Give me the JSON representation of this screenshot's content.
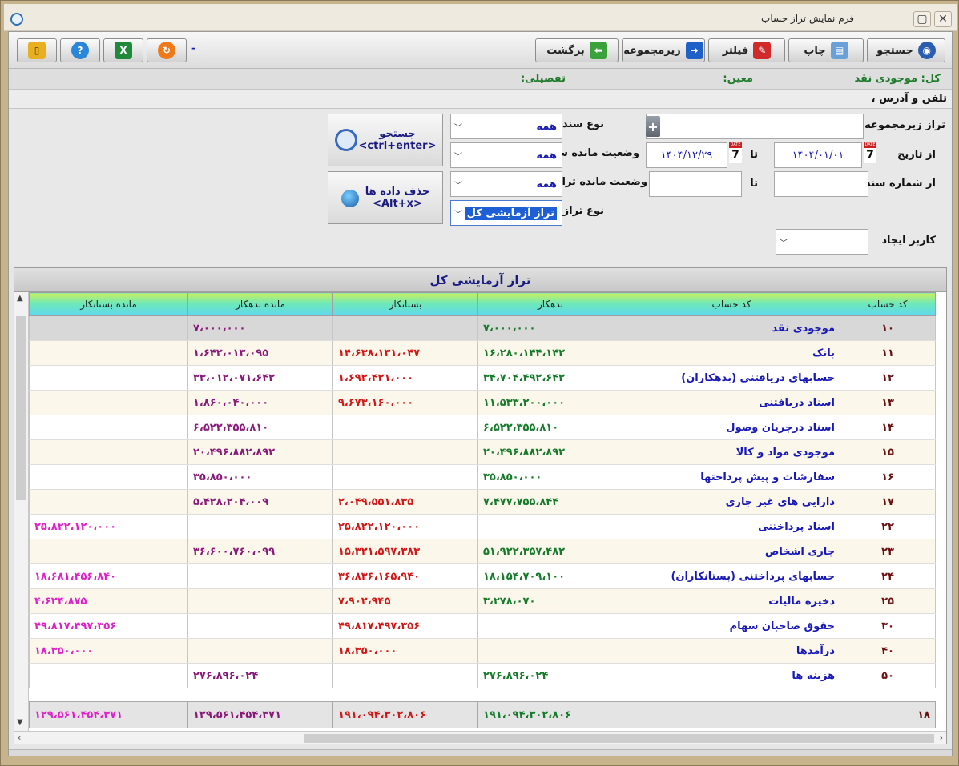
{
  "window": {
    "title": "فرم نمایش  تراز حساب"
  },
  "toolbar": {
    "search_label": "جستجو",
    "print_label": "چاپ",
    "filter_label": "فیلتر",
    "subgroup_label": "زیرمجموعه",
    "back_label": "برگشت",
    "separator_text": "-"
  },
  "info": {
    "kol": "کل: موجودی نقد",
    "moin": "معین:",
    "tafsili": "تفصیلی:"
  },
  "address": {
    "text": "تلفن و آدرس ،"
  },
  "filters": {
    "subgroup_balance_label": "تراز زیرمجموعه",
    "subgroup_balance_value": "",
    "doc_type_label": "نوع سند",
    "doc_type_value": "همه",
    "from_date_label": "از تاریخ",
    "from_date_value": "۱۴۰۴/۰۱/۰۱",
    "to_label": "تا",
    "to_date_value": "۱۴۰۴/۱۲/۲۹",
    "doc_remain_status_label": "وضعیت مانده سند",
    "doc_remain_status_value": "همه",
    "from_doc_no_label": "از شماره سند",
    "from_doc_no_value": "",
    "to_doc_no_value": "",
    "balance_remain_status_label": "وضعیت مانده تراز",
    "balance_remain_status_value": "همه",
    "balance_type_label": "نوع تراز",
    "balance_type_value": "تراز آزمایشی کل",
    "creator_label": "کاربر ایجاد",
    "creator_value": "",
    "calendar_top": "DATE",
    "calendar_num": "7"
  },
  "actions": {
    "search_line1": "جستجو",
    "search_line2": "<ctrl+enter>",
    "delete_line1": "حذف داده ها",
    "delete_line2": "<Alt+x>"
  },
  "grid": {
    "title": "تراز آزمایشی کل",
    "columns": [
      "کد حساب",
      "کد حساب",
      "بدهکار",
      "بستانکار",
      "مانده بدهکار",
      "مانده بستانکار"
    ],
    "rows": [
      {
        "code": "۱۰",
        "name": "موجودی نقد",
        "debit": "۷،۰۰۰،۰۰۰",
        "credit": "",
        "rem_debit": "۷،۰۰۰،۰۰۰",
        "rem_credit": ""
      },
      {
        "code": "۱۱",
        "name": "بانک",
        "debit": "۱۶،۲۸۰،۱۴۴،۱۴۲",
        "credit": "۱۴،۶۳۸،۱۳۱،۰۴۷",
        "rem_debit": "۱،۶۴۲،۰۱۳،۰۹۵",
        "rem_credit": ""
      },
      {
        "code": "۱۲",
        "name": "حسابهای دریافتنی (بدهکاران)",
        "debit": "۳۴،۷۰۴،۴۹۲،۶۴۲",
        "credit": "۱،۶۹۲،۴۲۱،۰۰۰",
        "rem_debit": "۳۳،۰۱۲،۰۷۱،۶۴۲",
        "rem_credit": ""
      },
      {
        "code": "۱۳",
        "name": "اسناد دریافتنی",
        "debit": "۱۱،۵۳۳،۲۰۰،۰۰۰",
        "credit": "۹،۶۷۳،۱۶۰،۰۰۰",
        "rem_debit": "۱،۸۶۰،۰۴۰،۰۰۰",
        "rem_credit": ""
      },
      {
        "code": "۱۴",
        "name": "اسناد درجریان وصول",
        "debit": "۶،۵۲۲،۳۵۵،۸۱۰",
        "credit": "",
        "rem_debit": "۶،۵۲۲،۳۵۵،۸۱۰",
        "rem_credit": ""
      },
      {
        "code": "۱۵",
        "name": "موجودی مواد و کالا",
        "debit": "۲۰،۴۹۶،۸۸۲،۸۹۲",
        "credit": "",
        "rem_debit": "۲۰،۴۹۶،۸۸۲،۸۹۲",
        "rem_credit": ""
      },
      {
        "code": "۱۶",
        "name": "سفارشات و پیش پرداختها",
        "debit": "۳۵،۸۵۰،۰۰۰",
        "credit": "",
        "rem_debit": "۳۵،۸۵۰،۰۰۰",
        "rem_credit": ""
      },
      {
        "code": "۱۷",
        "name": "دارایی های غیر جاری",
        "debit": "۷،۴۷۷،۷۵۵،۸۴۴",
        "credit": "۲،۰۴۹،۵۵۱،۸۳۵",
        "rem_debit": "۵،۴۲۸،۲۰۴،۰۰۹",
        "rem_credit": ""
      },
      {
        "code": "۲۲",
        "name": "اسناد پرداختنی",
        "debit": "",
        "credit": "۲۵،۸۲۲،۱۲۰،۰۰۰",
        "rem_debit": "",
        "rem_credit": "۲۵،۸۲۲،۱۲۰،۰۰۰"
      },
      {
        "code": "۲۳",
        "name": "جاری اشخاص",
        "debit": "۵۱،۹۲۲،۳۵۷،۴۸۲",
        "credit": "۱۵،۳۲۱،۵۹۷،۳۸۳",
        "rem_debit": "۳۶،۶۰۰،۷۶۰،۰۹۹",
        "rem_credit": ""
      },
      {
        "code": "۲۴",
        "name": "حسابهای پرداختنی (بستانکاران)",
        "debit": "۱۸،۱۵۴،۷۰۹،۱۰۰",
        "credit": "۳۶،۸۳۶،۱۶۵،۹۴۰",
        "rem_debit": "",
        "rem_credit": "۱۸،۶۸۱،۴۵۶،۸۴۰"
      },
      {
        "code": "۲۵",
        "name": "ذخیره مالیات",
        "debit": "۳،۲۷۸،۰۷۰",
        "credit": "۷،۹۰۲،۹۴۵",
        "rem_debit": "",
        "rem_credit": "۴،۶۲۴،۸۷۵"
      },
      {
        "code": "۳۰",
        "name": "حقوق صاحبان سهام",
        "debit": "",
        "credit": "۴۹،۸۱۷،۴۹۷،۳۵۶",
        "rem_debit": "",
        "rem_credit": "۴۹،۸۱۷،۴۹۷،۳۵۶"
      },
      {
        "code": "۴۰",
        "name": "درآمدها",
        "debit": "",
        "credit": "۱۸،۳۵۰،۰۰۰",
        "rem_debit": "",
        "rem_credit": "۱۸،۳۵۰،۰۰۰"
      },
      {
        "code": "۵۰",
        "name": "هزینه ها",
        "debit": "۲۷۶،۸۹۶،۰۲۴",
        "credit": "",
        "rem_debit": "۲۷۶،۸۹۶،۰۲۴",
        "rem_credit": ""
      }
    ],
    "footer": {
      "count": "۱۸",
      "debit": "۱۹۱،۰۹۴،۳۰۲،۸۰۶",
      "credit": "۱۹۱،۰۹۴،۳۰۲،۸۰۶",
      "rem_debit": "۱۲۹،۵۶۱،۴۵۴،۳۷۱",
      "rem_credit": "۱۲۹،۵۶۱،۴۵۴،۳۷۱"
    }
  },
  "colors": {
    "header_gradient": [
      "#c9f060",
      "#6ee8b8",
      "#5fd8f0"
    ],
    "debit": "#157a2a",
    "credit": "#d01818",
    "rem_debit": "#8a1a7a",
    "rem_credit": "#e020c8",
    "name": "#1818b8"
  }
}
